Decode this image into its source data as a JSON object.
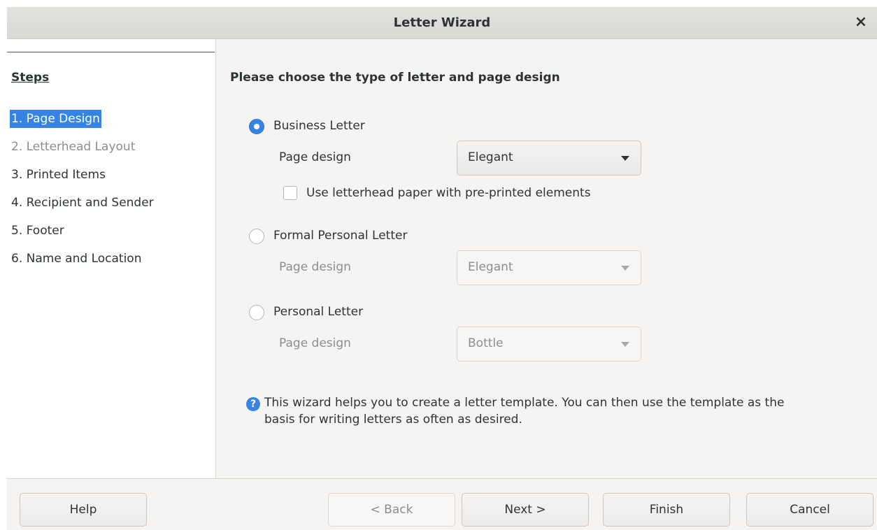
{
  "window": {
    "title": "Letter Wizard",
    "close_label": "×"
  },
  "sidebar": {
    "heading": "Steps",
    "items": [
      {
        "label": "1. Page Design",
        "state": "selected"
      },
      {
        "label": "2. Letterhead Layout",
        "state": "disabled"
      },
      {
        "label": "3. Printed Items",
        "state": "normal"
      },
      {
        "label": "4. Recipient and Sender",
        "state": "normal"
      },
      {
        "label": "5. Footer",
        "state": "normal"
      },
      {
        "label": "6. Name and Location",
        "state": "normal"
      }
    ]
  },
  "main": {
    "heading": "Please choose the type of letter and page design",
    "options": [
      {
        "label": "Business Letter",
        "checked": true,
        "design_label": "Page design",
        "design_value": "Elegant",
        "enabled": true
      },
      {
        "label": "Formal Personal Letter",
        "checked": false,
        "design_label": "Page design",
        "design_value": "Elegant",
        "enabled": false
      },
      {
        "label": "Personal Letter",
        "checked": false,
        "design_label": "Page design",
        "design_value": "Bottle",
        "enabled": false
      }
    ],
    "letterhead_checkbox": {
      "label": "Use letterhead paper with pre-printed elements",
      "checked": false
    },
    "info": {
      "icon": "info-icon",
      "text": "This wizard helps you to create a letter template. You can then use the template as the basis for writing letters as often as desired."
    }
  },
  "buttons": {
    "help": "Help",
    "back": "< Back",
    "next": "Next >",
    "finish": "Finish",
    "cancel": "Cancel"
  },
  "colors": {
    "accent": "#3584e4",
    "titlebar": "#dad8d5",
    "background": "#f5f4f2"
  }
}
